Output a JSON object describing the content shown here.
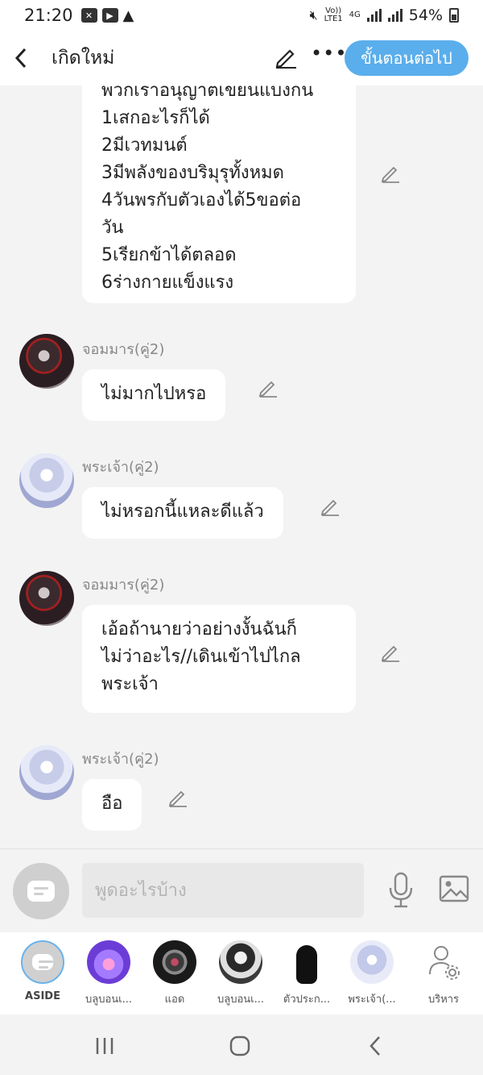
{
  "status_bar": {
    "time": "21:20",
    "network_top": "Vo))",
    "network_bottom": "LTE1",
    "net_type": "4G",
    "battery": "54%"
  },
  "header": {
    "title": "เกิดใหม่",
    "next_button": "ขั้นตอนต่อไป"
  },
  "messages": [
    {
      "sender": "",
      "cut_first_line": "พวกเราอนุญาตเขียนแบ่งกัน",
      "lines": [
        "1เสกอะไรก็ได้",
        "2มีเวทมนต์",
        "3มีพลังของบริมุรุทั้งหมด",
        "4วันพรกับตัวเองได้5ขอต่อ",
        "วัน",
        "5เรียกข้าได้ตลอด",
        "6ร่างกายแข็งแรง"
      ]
    },
    {
      "sender": "จอมมาร(คู่2)",
      "lines": [
        "ไม่มากไปหรอ"
      ]
    },
    {
      "sender": "พระเจ้า(คู่2)",
      "lines": [
        "ไม่หรอกนี้แหละดีแล้ว"
      ]
    },
    {
      "sender": "จอมมาร(คู่2)",
      "lines": [
        "เอ้อถ้านายว่าอย่างงั้นฉันก็",
        "ไม่ว่าอะไร//เดินเข้าไปไกล",
        "พระเจ้า"
      ]
    },
    {
      "sender": "พระเจ้า(คู่2)",
      "lines": [
        "อือ"
      ]
    }
  ],
  "composer": {
    "placeholder": "พูดอะไรบ้าง"
  },
  "characters": [
    {
      "label": "ASIDE"
    },
    {
      "label": "บลูบอนเ..."
    },
    {
      "label": "แอด"
    },
    {
      "label": "บลูบอนเ..."
    },
    {
      "label": "ตัวประก..."
    },
    {
      "label": "พระเจ้า(..."
    },
    {
      "label": "บริหาร"
    }
  ],
  "colors": {
    "accent": "#5aaeec",
    "background": "#f3f3f3",
    "bubble": "#ffffff"
  }
}
